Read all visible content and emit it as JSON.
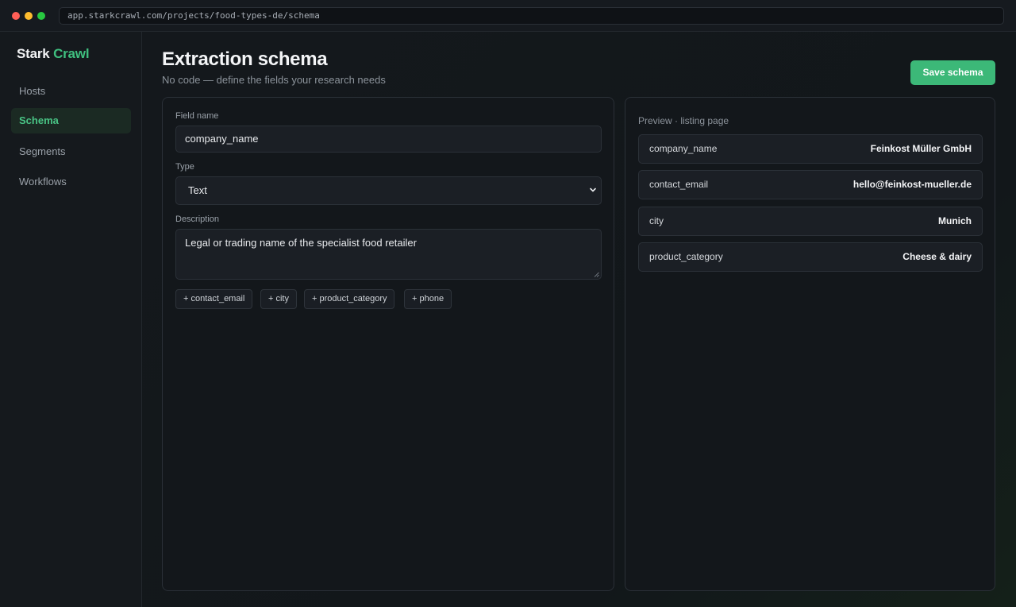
{
  "browser": {
    "url": "app.starkcrawl.com/projects/food-types-de/schema"
  },
  "brand": {
    "name_primary": "Stark",
    "name_accent": "Crawl",
    "accent_color": "#3fbf7f"
  },
  "sidebar": {
    "items": [
      {
        "label": "Hosts",
        "active": false
      },
      {
        "label": "Schema",
        "active": true
      },
      {
        "label": "Segments",
        "active": false
      },
      {
        "label": "Workflows",
        "active": false
      }
    ]
  },
  "header": {
    "title": "Extraction schema",
    "subtitle": "No code — define the fields your research needs",
    "save_label": "Save schema"
  },
  "form": {
    "field_name_label": "Field name",
    "field_name_value": "company_name",
    "type_label": "Type",
    "type_value": "Text",
    "description_label": "Description",
    "description_value": "Legal or trading name of the specialist food retailer",
    "suggestions": [
      "+ contact_email",
      "+ city",
      "+ product_category",
      "+ phone"
    ]
  },
  "preview": {
    "title": "Preview · listing page",
    "rows": [
      {
        "key": "company_name",
        "value": "Feinkost Müller GmbH"
      },
      {
        "key": "contact_email",
        "value": "hello@feinkost-mueller.de"
      },
      {
        "key": "city",
        "value": "Munich"
      },
      {
        "key": "product_category",
        "value": "Cheese & dairy"
      }
    ]
  }
}
